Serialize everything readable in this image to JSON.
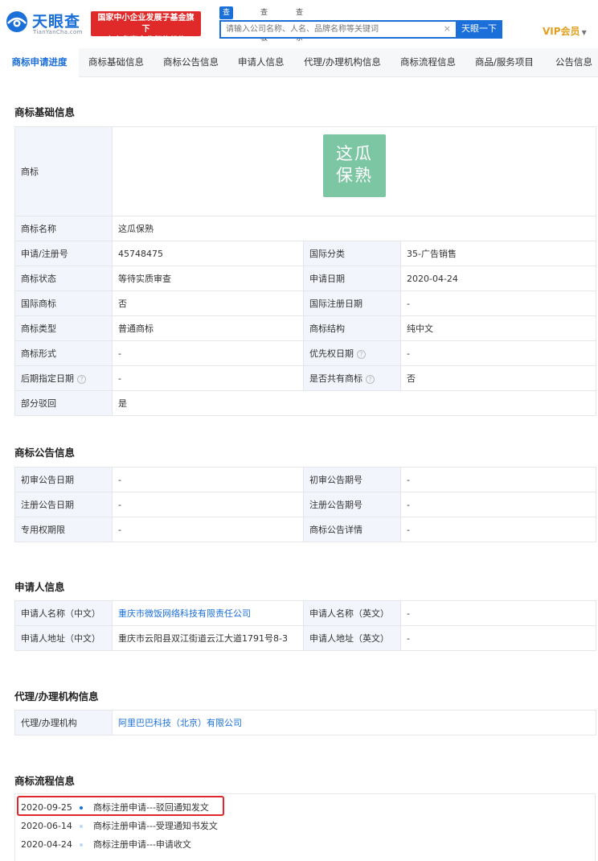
{
  "header": {
    "logo_text": "天眼查",
    "logo_sub": "TianYanCha.com",
    "promo_line1": "国家中小企业发展子基金旗下",
    "promo_line2": "官方备案企业征信机构",
    "search_tabs": [
      "查公司",
      "查老板",
      "查关系"
    ],
    "search_placeholder": "请输入公司名称、人名、品牌名称等关键词",
    "search_clear": "×",
    "search_button": "天眼一下",
    "vip_label": "VIP会员",
    "colors": {
      "brand": "#1a6fd8",
      "promo": "#e02a2a",
      "vip": "#e0a020"
    }
  },
  "nav": {
    "items": [
      "商标申请进度",
      "商标基础信息",
      "商标公告信息",
      "申请人信息",
      "代理/办理机构信息",
      "商标流程信息",
      "商品/服务项目",
      "公告信息"
    ],
    "active_index": 0
  },
  "basic": {
    "title": "商标基础信息",
    "trademark_label": "商标",
    "trademark_image_text_line1": "这瓜",
    "trademark_image_text_line2": "保熟",
    "name_label": "商标名称",
    "name_value": "这瓜保熟",
    "rows": [
      {
        "k1": "申请/注册号",
        "v1": "45748475",
        "k2": "国际分类",
        "v2": "35-广告销售"
      },
      {
        "k1": "商标状态",
        "v1": "等待实质审查",
        "k2": "申请日期",
        "v2": "2020-04-24"
      },
      {
        "k1": "国际商标",
        "v1": "否",
        "k2": "国际注册日期",
        "v2": "-"
      },
      {
        "k1": "商标类型",
        "v1": "普通商标",
        "k2": "商标结构",
        "v2": "纯中文"
      },
      {
        "k1": "商标形式",
        "v1": "-",
        "k2": "优先权日期",
        "v2": "-"
      },
      {
        "k1": "后期指定日期",
        "v1": "-",
        "k2": "是否共有商标",
        "v2": "否"
      }
    ],
    "last_label": "部分驳回",
    "last_value": "是",
    "help_glyph": "?"
  },
  "announce": {
    "title": "商标公告信息",
    "rows": [
      {
        "k1": "初审公告日期",
        "v1": "-",
        "k2": "初审公告期号",
        "v2": "-"
      },
      {
        "k1": "注册公告日期",
        "v1": "-",
        "k2": "注册公告期号",
        "v2": "-"
      },
      {
        "k1": "专用权期限",
        "v1": "-",
        "k2": "商标公告详情",
        "v2": "-"
      }
    ]
  },
  "applicant": {
    "title": "申请人信息",
    "rows": [
      {
        "k1": "申请人名称（中文）",
        "v1": "重庆市微饭网络科技有限责任公司",
        "k2": "申请人名称（英文）",
        "v2": "-"
      },
      {
        "k1": "申请人地址（中文）",
        "v1": "重庆市云阳县双江街道云江大道1791号8-3",
        "k2": "申请人地址（英文）",
        "v2": "-"
      }
    ]
  },
  "agency": {
    "title": "代理/办理机构信息",
    "label": "代理/办理机构",
    "value": "阿里巴巴科技（北京）有限公司"
  },
  "flow": {
    "title": "商标流程信息",
    "items": [
      {
        "date": "2020-09-25",
        "text": "商标注册申请---驳回通知发文"
      },
      {
        "date": "2020-06-14",
        "text": "商标注册申请---受理通知书发文"
      },
      {
        "date": "2020-04-24",
        "text": "商标注册申请---申请收文"
      }
    ]
  }
}
